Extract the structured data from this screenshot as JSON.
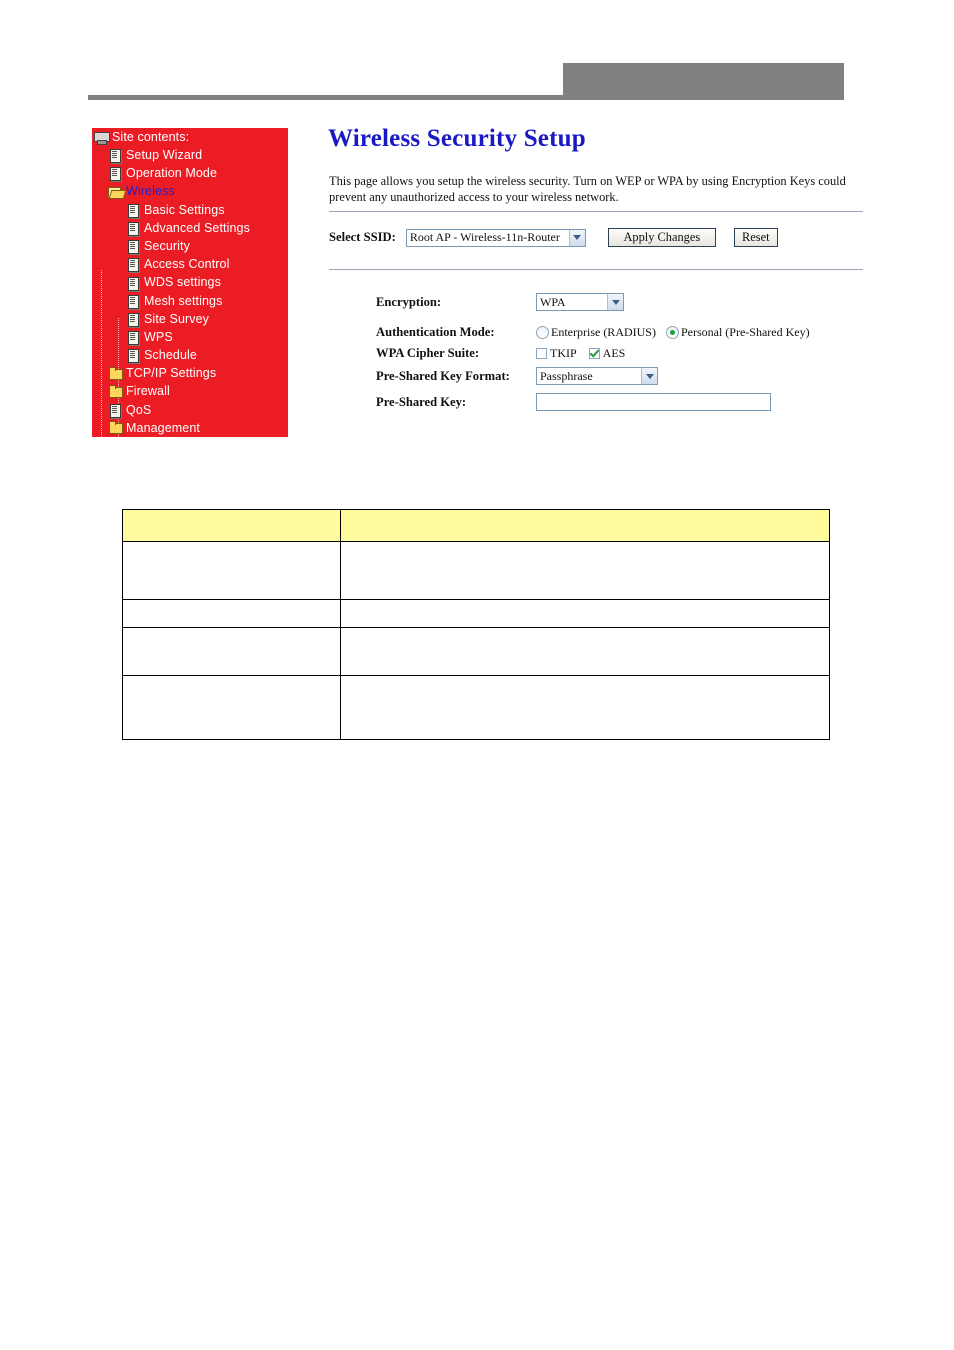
{
  "header": {
    "gray_block": "",
    "rule": ""
  },
  "sidebar": {
    "root_label": "Site contents:",
    "root_icon": "computer-icon",
    "items": [
      {
        "label": "Setup Wizard",
        "icon": "page-icon",
        "level": 1,
        "current": false
      },
      {
        "label": "Operation Mode",
        "icon": "page-icon",
        "level": 1,
        "current": false
      },
      {
        "label": "Wireless",
        "icon": "folder-open-icon",
        "level": 1,
        "current": true
      },
      {
        "label": "Basic Settings",
        "icon": "page-icon",
        "level": 2,
        "current": false
      },
      {
        "label": "Advanced Settings",
        "icon": "page-icon",
        "level": 2,
        "current": false
      },
      {
        "label": "Security",
        "icon": "page-icon",
        "level": 2,
        "current": false
      },
      {
        "label": "Access Control",
        "icon": "page-icon",
        "level": 2,
        "current": false
      },
      {
        "label": "WDS settings",
        "icon": "page-icon",
        "level": 2,
        "current": false
      },
      {
        "label": "Mesh settings",
        "icon": "page-icon",
        "level": 2,
        "current": false
      },
      {
        "label": "Site Survey",
        "icon": "page-icon",
        "level": 2,
        "current": false
      },
      {
        "label": "WPS",
        "icon": "page-icon",
        "level": 2,
        "current": false
      },
      {
        "label": "Schedule",
        "icon": "page-icon",
        "level": 2,
        "current": false
      },
      {
        "label": "TCP/IP Settings",
        "icon": "folder-icon",
        "level": 1,
        "current": false
      },
      {
        "label": "Firewall",
        "icon": "folder-icon",
        "level": 1,
        "current": false
      },
      {
        "label": "QoS",
        "icon": "page-icon",
        "level": 1,
        "current": false
      },
      {
        "label": "Management",
        "icon": "folder-icon",
        "level": 1,
        "current": false
      }
    ]
  },
  "main": {
    "title": "Wireless Security Setup",
    "description": "This page allows you setup the wireless security. Turn on WEP or WPA by using Encryption Keys could prevent any unauthorized access to your wireless network.",
    "ssid": {
      "label": "Select SSID:",
      "value": "Root AP - Wireless-11n-Router"
    },
    "apply_label": "Apply Changes",
    "reset_label": "Reset",
    "fields": {
      "encryption_label": "Encryption:",
      "encryption_value": "WPA",
      "auth_mode_label": "Authentication Mode:",
      "auth_enterprise_label": "Enterprise (RADIUS)",
      "auth_personal_label": "Personal (Pre-Shared Key)",
      "cipher_label": "WPA Cipher Suite:",
      "cipher_tkip_label": "TKIP",
      "cipher_aes_label": "AES",
      "psk_format_label": "Pre-Shared Key Format:",
      "psk_format_value": "Passphrase",
      "psk_label": "Pre-Shared Key:",
      "psk_value": ""
    }
  },
  "table": {
    "header": {
      "col_a": "",
      "col_b": ""
    },
    "rows": [
      {
        "col_a": "",
        "col_b": ""
      },
      {
        "col_a": "",
        "col_b": ""
      },
      {
        "col_a": "",
        "col_b": ""
      },
      {
        "col_a": "",
        "col_b": ""
      }
    ]
  },
  "colors": {
    "sidebar_bg": "#ec1c24",
    "title_blue": "#1a1ac4",
    "table_header_yellow": "#fdfb9b",
    "header_gray": "#808080",
    "check_green": "#1e9b3c"
  }
}
